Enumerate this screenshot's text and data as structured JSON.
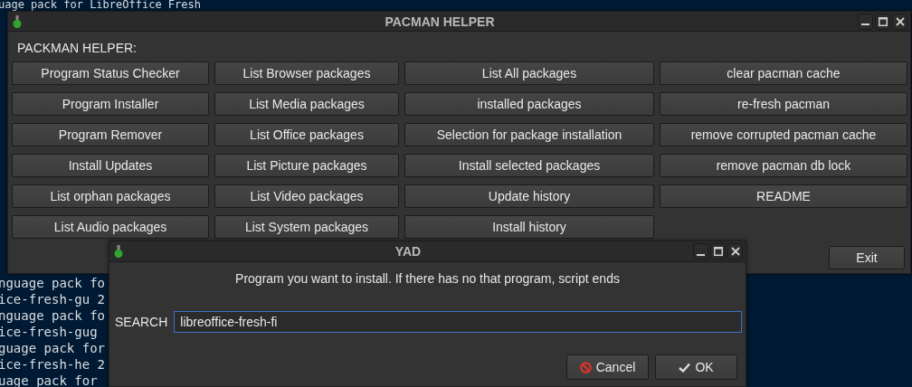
{
  "terminal": {
    "top_line": "uage pack for LibreOffice Fresh",
    "lines": [
      "nguage pack fo",
      "ice-fresh-gu 2",
      "nguage pack fo",
      "ice-fresh-gug",
      "guage pack for",
      "ice-fresh-he 2",
      "uage pack for"
    ]
  },
  "main_window": {
    "title": "PACMAN HELPER",
    "heading": "PACKMAN HELPER:",
    "buttons": [
      "Program Status Checker",
      "List Browser packages",
      "List All packages",
      "clear pacman cache",
      "Program Installer",
      "List Media packages",
      "installed packages",
      "re-fresh pacman",
      "Program Remover",
      "List Office packages",
      "Selection for package installation",
      "remove corrupted pacman cache",
      "Install Updates",
      "List Picture packages",
      "Install selected packages",
      "remove pacman db lock",
      "List orphan packages",
      "List Video packages",
      "Update history",
      "README",
      "List Audio packages",
      "List System packages",
      "Install history"
    ],
    "exit_button": "Exit"
  },
  "dialog": {
    "title": "YAD",
    "message": "Program you want to install. If there has no that program, script ends",
    "search_label": "SEARCH",
    "search_value": "libreoffice-fresh-fi",
    "buttons": [
      {
        "kind": "cancel",
        "label": "Cancel"
      },
      {
        "kind": "ok",
        "label": "OK"
      }
    ]
  }
}
